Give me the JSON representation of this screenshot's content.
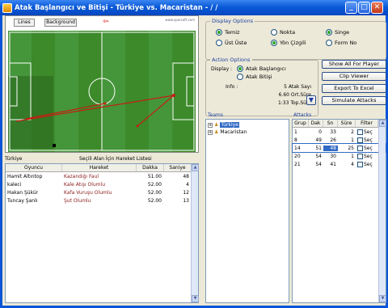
{
  "window": {
    "title": "Atak Başlangıcı ve Bitişi - Türkiye vs. Macaristan -  / /"
  },
  "pitch": {
    "tab_lines": "Lines",
    "tab_background": "Background",
    "logo": "www.sporsoft.com"
  },
  "events_panel": {
    "team": "Türkiye",
    "title": "Seçili Alan İçin Hareket Listesi",
    "columns": [
      "Oyuncu",
      "Hareket",
      "Dakka",
      "Saniye"
    ],
    "rows": [
      [
        "Hamit Altıntop",
        "Kazandığı Faul",
        "51.00",
        "48"
      ],
      [
        "kaleci",
        "Kale Atışı Olumlu",
        "52.00",
        "4"
      ],
      [
        "Hakan Şükür",
        "Kafa Vuruşu Olumlu",
        "52.00",
        "12"
      ],
      [
        "Tuncay Şanlı",
        "Şut Olumlu",
        "52.00",
        "13"
      ]
    ]
  },
  "display_options": {
    "title": "Display Options",
    "options": [
      {
        "label": "Temiz",
        "selected": true
      },
      {
        "label": "Nokta",
        "selected": false
      },
      {
        "label": "Singe",
        "selected": true
      },
      {
        "label": "Üst Üste",
        "selected": false
      },
      {
        "label": "Yön Çizgili",
        "selected": true
      },
      {
        "label": "Form No",
        "selected": false
      }
    ]
  },
  "action_options": {
    "title": "Action Options",
    "display_label": "Display :",
    "opt_start": "Atak Başlangıcı",
    "opt_end": "Atak Bitişi",
    "info_label": "Info :",
    "info": [
      "5 Atak Sayı",
      "6.60 Ort.Süre",
      "1:33 Top.Süre"
    ]
  },
  "buttons": {
    "show_all": "Show All For Player",
    "clip_viewer": "Clip Viewer",
    "export": "Export To Excel",
    "simulate": "Simulate Attacks"
  },
  "teams": {
    "title": "Teams",
    "items": [
      "Türkiye",
      "Macaristan"
    ]
  },
  "attacks": {
    "title": "Attacks",
    "columns": [
      "Grup",
      "Dak",
      "Sn",
      "Süre",
      "Filter"
    ],
    "check_label": "Seç",
    "rows": [
      [
        "1",
        "0",
        "33",
        "2"
      ],
      [
        "8",
        "49",
        "26",
        "1"
      ],
      [
        "14",
        "51",
        "48",
        "25"
      ],
      [
        "20",
        "54",
        "30",
        "1"
      ],
      [
        "21",
        "54",
        "41",
        "4"
      ]
    ],
    "selected_row": 2
  }
}
